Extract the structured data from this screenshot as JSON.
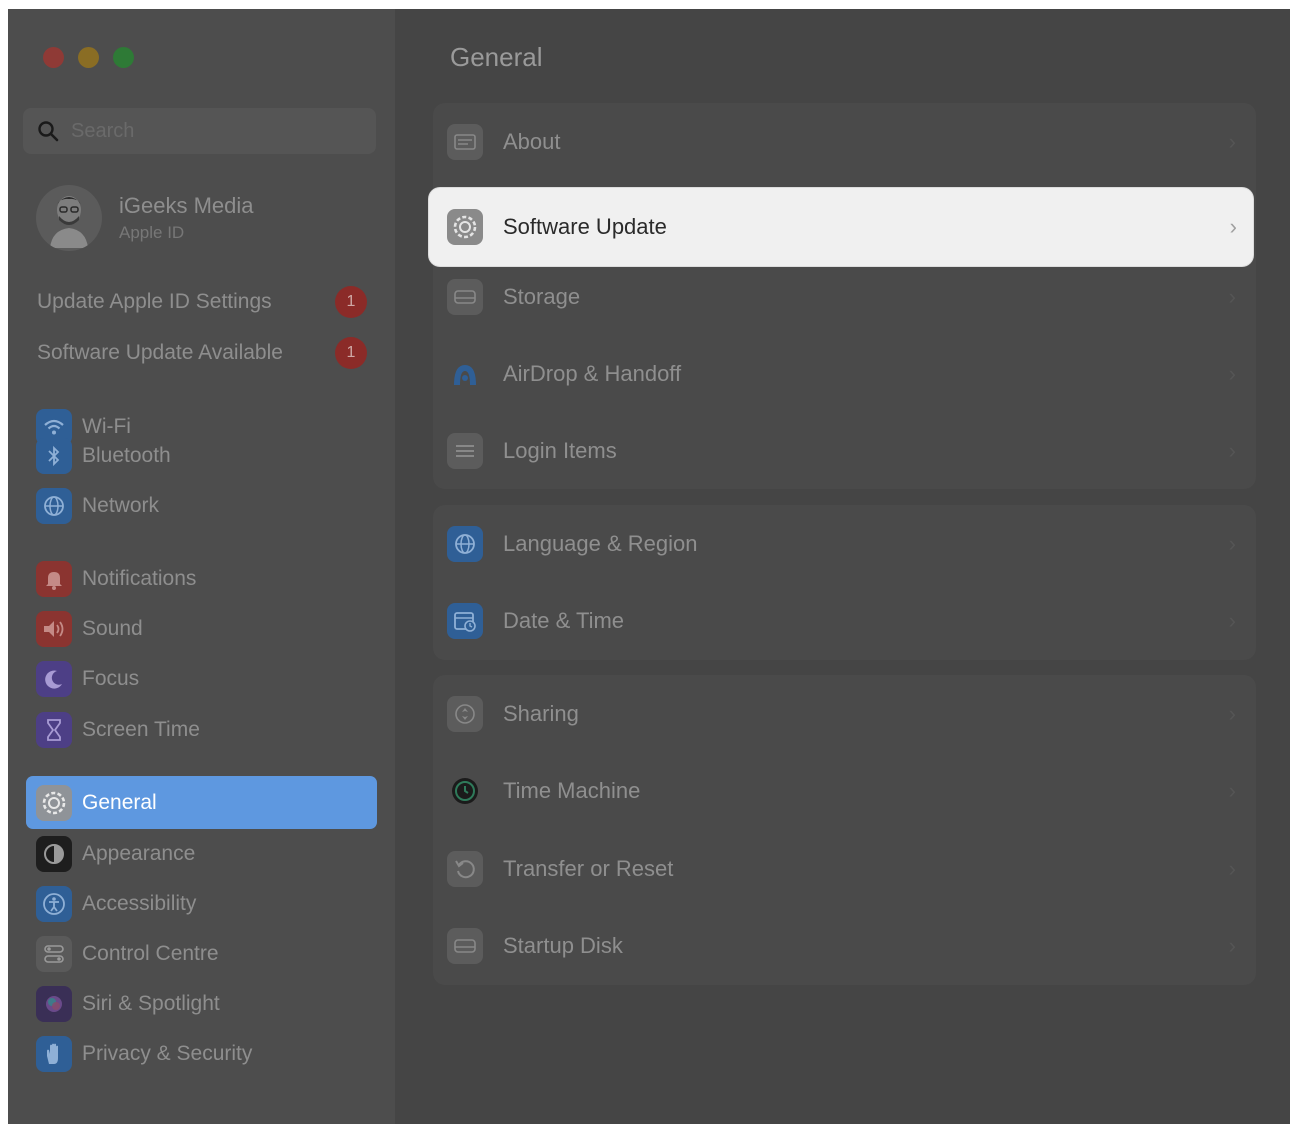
{
  "sidebar": {
    "search_placeholder": "Search",
    "profile": {
      "name": "iGeeks Media",
      "subtitle": "Apple ID"
    },
    "alerts": [
      {
        "label": "Update Apple ID Settings",
        "badge": "1"
      },
      {
        "label": "Software Update Available",
        "badge": "1"
      }
    ],
    "items": [
      {
        "label": "Wi-Fi",
        "icon": "wifi-icon",
        "color": "#2f5f96"
      },
      {
        "label": "Bluetooth",
        "icon": "bluetooth-icon",
        "color": "#2f5f96"
      },
      {
        "label": "Network",
        "icon": "globe-icon",
        "color": "#2f5f96"
      },
      {
        "label": "Notifications",
        "icon": "bell-icon",
        "color": "#8b3430"
      },
      {
        "label": "Sound",
        "icon": "speaker-icon",
        "color": "#8b3430"
      },
      {
        "label": "Focus",
        "icon": "moon-icon",
        "color": "#4d3f86"
      },
      {
        "label": "Screen Time",
        "icon": "hourglass-icon",
        "color": "#4d3f86"
      },
      {
        "label": "General",
        "icon": "gear-icon",
        "color": "#8f9398",
        "selected": true
      },
      {
        "label": "Appearance",
        "icon": "appearance-icon",
        "color": "#1e1e1e"
      },
      {
        "label": "Accessibility",
        "icon": "accessibility-icon",
        "color": "#2f5f96"
      },
      {
        "label": "Control Centre",
        "icon": "control-centre-icon",
        "color": "#5a5a5a"
      },
      {
        "label": "Siri & Spotlight",
        "icon": "siri-icon",
        "color": "#3a2f56"
      },
      {
        "label": "Privacy & Security",
        "icon": "hand-icon",
        "color": "#2f5f96"
      }
    ]
  },
  "main": {
    "title": "General",
    "rows": [
      {
        "label": "About",
        "icon": "about-icon",
        "color": "#5c5c5c"
      },
      {
        "label": "Software Update",
        "icon": "software-update-icon",
        "color": "#8a8a8a",
        "selected": true
      },
      {
        "label": "Storage",
        "icon": "storage-icon",
        "color": "#5c5c5c"
      },
      {
        "label": "AirDrop & Handoff",
        "icon": "airdrop-icon",
        "color": "#2f5f96"
      },
      {
        "label": "Login Items",
        "icon": "login-items-icon",
        "color": "#5c5c5c"
      },
      {
        "label": "Language & Region",
        "icon": "language-globe-icon",
        "color": "#2f5f96"
      },
      {
        "label": "Date & Time",
        "icon": "calendar-clock-icon",
        "color": "#2f5f96"
      },
      {
        "label": "Sharing",
        "icon": "sharing-icon",
        "color": "#5c5c5c"
      },
      {
        "label": "Time Machine",
        "icon": "time-machine-icon",
        "color": "#2e4a3e"
      },
      {
        "label": "Transfer or Reset",
        "icon": "reset-icon",
        "color": "#5c5c5c"
      },
      {
        "label": "Startup Disk",
        "icon": "disk-icon",
        "color": "#5c5c5c"
      }
    ],
    "chevron": "›"
  }
}
